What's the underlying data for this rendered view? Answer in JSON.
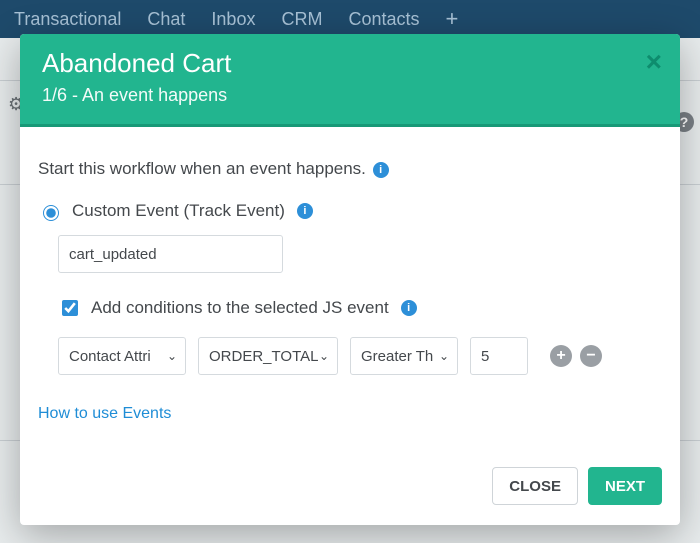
{
  "topnav": {
    "items": [
      "Transactional",
      "Chat",
      "Inbox",
      "CRM",
      "Contacts"
    ]
  },
  "modal": {
    "title": "Abandoned Cart",
    "subtitle": "1/6 - An event happens",
    "intro": "Start this workflow when an event happens.",
    "custom_event_label": "Custom Event (Track Event)",
    "event_value": "cart_updated",
    "add_conditions_label": "Add conditions to the selected JS event",
    "condition": {
      "field_type": "Contact Attri",
      "field_name": "ORDER_TOTAL",
      "operator": "Greater Th",
      "value": "5"
    },
    "help_link": "How to use Events",
    "close_label": "CLOSE",
    "next_label": "NEXT"
  }
}
